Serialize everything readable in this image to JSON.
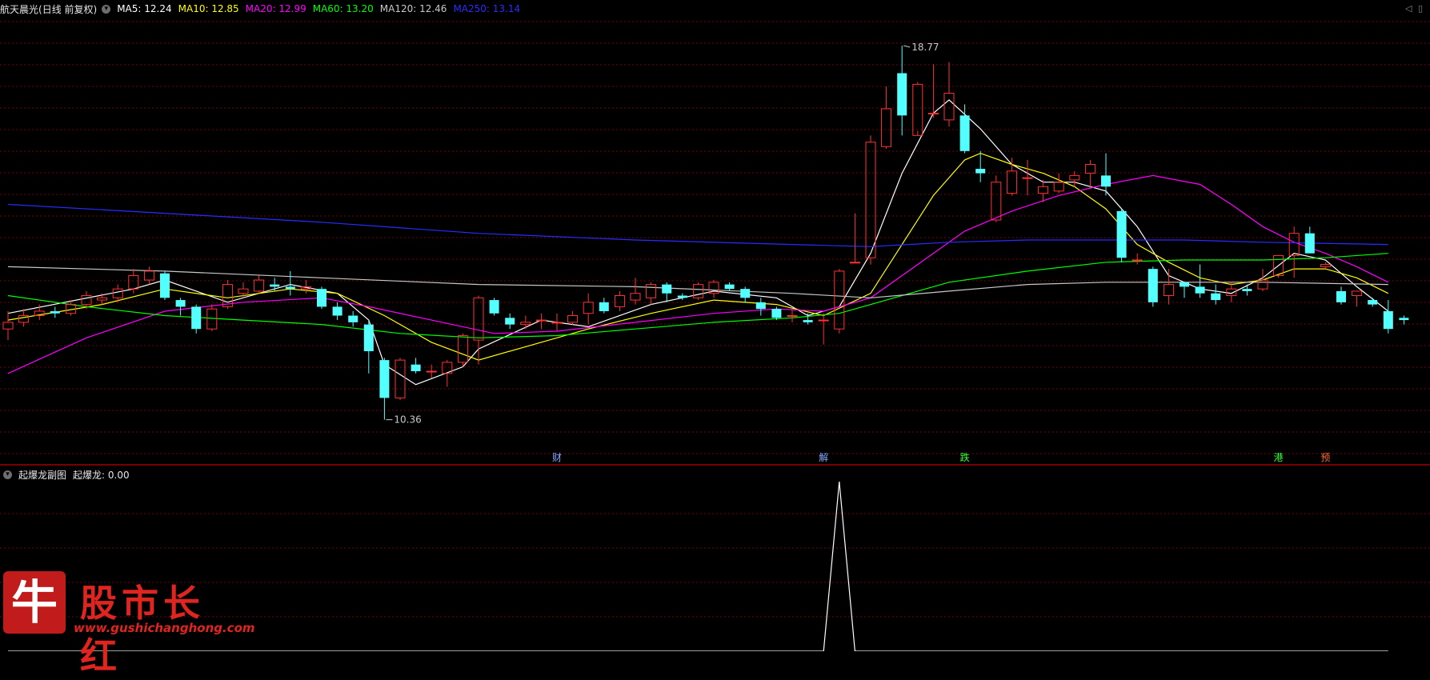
{
  "header": {
    "stock_name": "航天晨光",
    "period_label": "(日线 前复权)",
    "indicators": [
      {
        "label": "MA5: 12.24",
        "color": "#ffffff"
      },
      {
        "label": "MA10: 12.85",
        "color": "#ffff00"
      },
      {
        "label": "MA20: 12.99",
        "color": "#ff00ff"
      },
      {
        "label": "MA60: 13.20",
        "color": "#00ff00"
      },
      {
        "label": "MA120: 12.46",
        "color": "#c8c8c8"
      },
      {
        "label": "MA250: 13.14",
        "color": "#2b2bff"
      }
    ]
  },
  "sub_panel": {
    "name": "起爆龙副图",
    "indicator_label": "起爆龙: 0.00"
  },
  "watermark": {
    "logo_char": "牛",
    "name": "股市长红",
    "url": "www.gushichanghong.com"
  },
  "colors": {
    "up": "#ff3232",
    "down": "#54ffff",
    "grid": "#7a0000",
    "divider": "#a00000",
    "ma5": "#ffffff",
    "ma10": "#ffff00",
    "ma20": "#ff00ff",
    "ma60": "#00ff00",
    "ma120": "#c8c8c8",
    "ma250": "#2b2bff",
    "signal": "#ffffff"
  },
  "chart_data": {
    "type": "candlestick",
    "x": "trading day index",
    "y_range": [
      9.4,
      19.4
    ],
    "price_annotations": [
      {
        "label": "18.77",
        "value": 18.77,
        "index": 57
      },
      {
        "label": "10.36",
        "value": 10.36,
        "index": 24
      }
    ],
    "event_markers": [
      {
        "label": "财",
        "index": 35,
        "color": "#7fa8ff"
      },
      {
        "label": "解",
        "index": 52,
        "color": "#7fa8ff"
      },
      {
        "label": "跌",
        "index": 61,
        "color": "#39ff39"
      },
      {
        "label": "港",
        "index": 81,
        "color": "#39ff39"
      },
      {
        "label": "预",
        "index": 84,
        "color": "#ff6a3a"
      }
    ],
    "candles": [
      [
        12.4,
        12.55,
        12.15,
        12.8
      ],
      [
        12.55,
        12.7,
        12.45,
        12.85
      ],
      [
        12.7,
        12.8,
        12.6,
        12.95
      ],
      [
        12.8,
        12.75,
        12.65,
        12.9
      ],
      [
        12.75,
        12.95,
        12.7,
        13.05
      ],
      [
        12.95,
        13.15,
        12.85,
        13.25
      ],
      [
        13.05,
        13.1,
        12.95,
        13.2
      ],
      [
        13.1,
        13.3,
        13.0,
        13.4
      ],
      [
        13.3,
        13.6,
        13.2,
        13.75
      ],
      [
        13.5,
        13.7,
        13.4,
        13.8
      ],
      [
        13.65,
        13.1,
        13.05,
        13.7
      ],
      [
        13.05,
        12.9,
        12.7,
        13.1
      ],
      [
        12.9,
        12.4,
        12.3,
        12.95
      ],
      [
        12.4,
        12.85,
        12.35,
        12.95
      ],
      [
        12.9,
        13.4,
        12.85,
        13.5
      ],
      [
        13.2,
        13.3,
        13.1,
        13.45
      ],
      [
        13.25,
        13.5,
        13.2,
        13.6
      ],
      [
        13.4,
        13.35,
        13.25,
        13.55
      ],
      [
        13.35,
        13.3,
        13.15,
        13.7
      ],
      [
        13.3,
        13.35,
        13.2,
        13.5
      ],
      [
        13.3,
        12.9,
        12.85,
        13.35
      ],
      [
        12.9,
        12.7,
        12.6,
        13.0
      ],
      [
        12.7,
        12.55,
        12.45,
        12.8
      ],
      [
        12.5,
        11.9,
        11.4,
        12.6
      ],
      [
        11.7,
        10.85,
        10.36,
        11.75
      ],
      [
        10.85,
        11.7,
        10.8,
        11.75
      ],
      [
        11.6,
        11.45,
        11.4,
        11.75
      ],
      [
        11.45,
        11.45,
        11.3,
        11.6
      ],
      [
        11.4,
        11.65,
        11.1,
        11.7
      ],
      [
        11.65,
        12.25,
        11.55,
        12.3
      ],
      [
        12.15,
        13.1,
        11.6,
        13.15
      ],
      [
        13.05,
        12.75,
        12.7,
        13.1
      ],
      [
        12.65,
        12.5,
        12.4,
        12.75
      ],
      [
        12.5,
        12.55,
        12.4,
        12.7
      ],
      [
        12.6,
        12.6,
        12.4,
        12.75
      ],
      [
        12.55,
        12.55,
        12.35,
        12.75
      ],
      [
        12.55,
        12.7,
        12.5,
        12.8
      ],
      [
        12.75,
        13.0,
        12.5,
        13.2
      ],
      [
        13.0,
        12.8,
        12.75,
        13.1
      ],
      [
        12.9,
        13.15,
        12.8,
        13.25
      ],
      [
        13.05,
        13.2,
        12.95,
        13.55
      ],
      [
        13.1,
        13.4,
        12.95,
        13.45
      ],
      [
        13.4,
        13.2,
        13.0,
        13.45
      ],
      [
        13.15,
        13.1,
        13.05,
        13.2
      ],
      [
        13.1,
        13.4,
        13.05,
        13.45
      ],
      [
        13.2,
        13.45,
        13.1,
        13.5
      ],
      [
        13.4,
        13.3,
        13.25,
        13.45
      ],
      [
        13.3,
        13.1,
        13.0,
        13.35
      ],
      [
        13.0,
        12.85,
        12.7,
        13.1
      ],
      [
        12.85,
        12.65,
        12.6,
        12.9
      ],
      [
        12.7,
        12.7,
        12.55,
        12.85
      ],
      [
        12.6,
        12.55,
        12.5,
        12.75
      ],
      [
        12.6,
        12.6,
        12.05,
        12.75
      ],
      [
        12.4,
        13.7,
        12.3,
        13.75
      ],
      [
        13.9,
        13.9,
        13.9,
        15.0
      ],
      [
        14.0,
        16.6,
        13.85,
        16.75
      ],
      [
        16.5,
        17.35,
        16.45,
        17.85
      ],
      [
        18.15,
        17.2,
        16.75,
        18.77
      ],
      [
        16.75,
        17.9,
        16.85,
        17.95
      ],
      [
        17.25,
        17.25,
        17.15,
        18.35
      ],
      [
        17.1,
        17.7,
        16.95,
        18.4
      ],
      [
        17.2,
        16.4,
        16.35,
        17.45
      ],
      [
        16.0,
        15.9,
        15.7,
        16.4
      ],
      [
        14.85,
        15.7,
        14.8,
        15.85
      ],
      [
        15.45,
        15.95,
        15.4,
        16.25
      ],
      [
        15.8,
        15.8,
        15.4,
        16.2
      ],
      [
        15.45,
        15.6,
        15.25,
        15.75
      ],
      [
        15.5,
        15.7,
        15.45,
        15.9
      ],
      [
        15.75,
        15.85,
        15.6,
        15.95
      ],
      [
        15.9,
        16.1,
        15.55,
        16.2
      ],
      [
        15.85,
        15.6,
        15.4,
        16.35
      ],
      [
        15.05,
        14.0,
        13.9,
        15.1
      ],
      [
        13.95,
        13.95,
        13.85,
        14.1
      ],
      [
        13.75,
        13.0,
        12.9,
        13.8
      ],
      [
        13.15,
        13.4,
        12.95,
        13.75
      ],
      [
        13.45,
        13.35,
        13.1,
        13.45
      ],
      [
        13.35,
        13.2,
        13.1,
        13.85
      ],
      [
        13.2,
        13.05,
        12.95,
        13.4
      ],
      [
        13.15,
        13.3,
        13.0,
        13.45
      ],
      [
        13.3,
        13.25,
        13.15,
        13.4
      ],
      [
        13.3,
        13.5,
        13.25,
        13.75
      ],
      [
        13.6,
        14.05,
        13.55,
        14.05
      ],
      [
        14.05,
        14.55,
        13.55,
        14.7
      ],
      [
        14.55,
        14.1,
        14.1,
        14.7
      ],
      [
        13.8,
        13.85,
        13.75,
        13.9
      ],
      [
        13.25,
        13.0,
        12.95,
        13.35
      ],
      [
        13.15,
        13.25,
        12.9,
        13.25
      ],
      [
        13.05,
        12.95,
        12.9,
        13.1
      ],
      [
        12.8,
        12.4,
        12.3,
        13.05
      ],
      [
        12.65,
        12.6,
        12.5,
        12.7
      ]
    ],
    "moving_averages": [
      {
        "name": "MA5",
        "color": "#ffffff",
        "points": [
          [
            0,
            12.75
          ],
          [
            8,
            13.3
          ],
          [
            10,
            13.5
          ],
          [
            14,
            13.0
          ],
          [
            18,
            13.4
          ],
          [
            21,
            13.2
          ],
          [
            23,
            12.6
          ],
          [
            24,
            11.6
          ],
          [
            26,
            11.15
          ],
          [
            29,
            11.55
          ],
          [
            30,
            11.95
          ],
          [
            34,
            12.6
          ],
          [
            37,
            12.45
          ],
          [
            41,
            12.95
          ],
          [
            45,
            13.25
          ],
          [
            49,
            13.1
          ],
          [
            51,
            12.7
          ],
          [
            53,
            12.9
          ],
          [
            55,
            14.1
          ],
          [
            57,
            15.9
          ],
          [
            59,
            17.25
          ],
          [
            60,
            17.55
          ],
          [
            62,
            16.9
          ],
          [
            64,
            16.1
          ],
          [
            66,
            15.7
          ],
          [
            68,
            15.7
          ],
          [
            70,
            15.5
          ],
          [
            72,
            14.7
          ],
          [
            74,
            13.6
          ],
          [
            76,
            13.3
          ],
          [
            78,
            13.2
          ],
          [
            80,
            13.55
          ],
          [
            82,
            14.1
          ],
          [
            84,
            13.95
          ],
          [
            86,
            13.35
          ],
          [
            88,
            12.8
          ]
        ]
      },
      {
        "name": "MA10",
        "color": "#ffff00",
        "points": [
          [
            0,
            12.6
          ],
          [
            6,
            12.95
          ],
          [
            10,
            13.3
          ],
          [
            14,
            13.1
          ],
          [
            18,
            13.3
          ],
          [
            21,
            13.2
          ],
          [
            24,
            12.7
          ],
          [
            27,
            12.1
          ],
          [
            30,
            11.7
          ],
          [
            33,
            12.0
          ],
          [
            37,
            12.4
          ],
          [
            41,
            12.75
          ],
          [
            45,
            13.05
          ],
          [
            49,
            12.95
          ],
          [
            52,
            12.7
          ],
          [
            55,
            13.2
          ],
          [
            57,
            14.3
          ],
          [
            59,
            15.4
          ],
          [
            61,
            16.2
          ],
          [
            62,
            16.35
          ],
          [
            64,
            16.1
          ],
          [
            66,
            15.9
          ],
          [
            68,
            15.6
          ],
          [
            70,
            15.1
          ],
          [
            72,
            14.3
          ],
          [
            74,
            13.9
          ],
          [
            76,
            13.55
          ],
          [
            78,
            13.4
          ],
          [
            80,
            13.5
          ],
          [
            82,
            13.75
          ],
          [
            84,
            13.75
          ],
          [
            86,
            13.55
          ],
          [
            88,
            13.2
          ]
        ]
      },
      {
        "name": "MA20",
        "color": "#ff00ff",
        "points": [
          [
            0,
            11.4
          ],
          [
            5,
            12.2
          ],
          [
            10,
            12.8
          ],
          [
            15,
            13.0
          ],
          [
            20,
            13.1
          ],
          [
            23,
            12.9
          ],
          [
            27,
            12.6
          ],
          [
            31,
            12.3
          ],
          [
            35,
            12.35
          ],
          [
            40,
            12.55
          ],
          [
            45,
            12.75
          ],
          [
            49,
            12.85
          ],
          [
            52,
            12.8
          ],
          [
            55,
            13.1
          ],
          [
            58,
            13.85
          ],
          [
            61,
            14.6
          ],
          [
            64,
            15.05
          ],
          [
            67,
            15.4
          ],
          [
            70,
            15.65
          ],
          [
            73,
            15.85
          ],
          [
            76,
            15.65
          ],
          [
            78,
            15.2
          ],
          [
            80,
            14.7
          ],
          [
            82,
            14.35
          ],
          [
            84,
            14.1
          ],
          [
            86,
            13.8
          ],
          [
            88,
            13.45
          ]
        ]
      },
      {
        "name": "MA60",
        "color": "#00ff00",
        "points": [
          [
            0,
            13.15
          ],
          [
            5,
            12.9
          ],
          [
            10,
            12.7
          ],
          [
            15,
            12.6
          ],
          [
            20,
            12.5
          ],
          [
            25,
            12.3
          ],
          [
            30,
            12.2
          ],
          [
            35,
            12.25
          ],
          [
            40,
            12.4
          ],
          [
            45,
            12.55
          ],
          [
            50,
            12.65
          ],
          [
            53,
            12.75
          ],
          [
            56,
            13.05
          ],
          [
            60,
            13.45
          ],
          [
            65,
            13.7
          ],
          [
            70,
            13.9
          ],
          [
            75,
            13.95
          ],
          [
            80,
            13.95
          ],
          [
            84,
            14.0
          ],
          [
            88,
            14.1
          ]
        ]
      },
      {
        "name": "MA120",
        "color": "#c8c8c8",
        "points": [
          [
            0,
            13.8
          ],
          [
            10,
            13.7
          ],
          [
            20,
            13.55
          ],
          [
            30,
            13.4
          ],
          [
            40,
            13.35
          ],
          [
            50,
            13.2
          ],
          [
            55,
            13.1
          ],
          [
            60,
            13.25
          ],
          [
            65,
            13.4
          ],
          [
            70,
            13.45
          ],
          [
            75,
            13.45
          ],
          [
            80,
            13.45
          ],
          [
            88,
            13.4
          ]
        ]
      },
      {
        "name": "MA250",
        "color": "#2b2bff",
        "points": [
          [
            0,
            15.2
          ],
          [
            10,
            15.0
          ],
          [
            20,
            14.8
          ],
          [
            30,
            14.55
          ],
          [
            40,
            14.4
          ],
          [
            50,
            14.3
          ],
          [
            55,
            14.25
          ],
          [
            60,
            14.35
          ],
          [
            65,
            14.4
          ],
          [
            70,
            14.4
          ],
          [
            75,
            14.4
          ],
          [
            80,
            14.35
          ],
          [
            88,
            14.3
          ]
        ]
      }
    ],
    "sub_series": {
      "name": "起爆龙",
      "y_range": [
        0,
        1
      ],
      "points": [
        [
          0,
          0
        ],
        [
          52,
          0
        ],
        [
          53,
          1
        ],
        [
          54,
          0
        ],
        [
          88,
          0
        ]
      ]
    }
  }
}
